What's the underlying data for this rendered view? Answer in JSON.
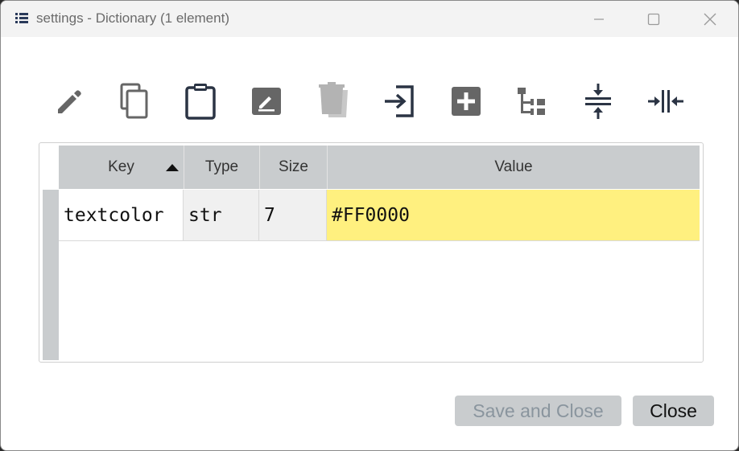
{
  "window": {
    "title": "settings - Dictionary (1 element)"
  },
  "toolbar": {
    "tools": [
      {
        "icon": "edit-pencil-icon"
      },
      {
        "icon": "copy-icon"
      },
      {
        "icon": "paste-clipboard-icon"
      },
      {
        "icon": "rename-icon"
      },
      {
        "icon": "delete-icon"
      },
      {
        "icon": "import-icon"
      },
      {
        "icon": "insert-icon"
      },
      {
        "icon": "tree-view-icon"
      },
      {
        "icon": "collapse-rows-icon"
      },
      {
        "icon": "resize-columns-icon"
      }
    ]
  },
  "table": {
    "columns": {
      "key": "Key",
      "type": "Type",
      "size": "Size",
      "value": "Value"
    },
    "sorted_column": "Key",
    "rows": [
      {
        "key": "textcolor",
        "type": "str",
        "size": "7",
        "value": "#FF0000"
      }
    ]
  },
  "buttons": {
    "save_close": "Save and Close",
    "close": "Close"
  },
  "colors": {
    "header_bg": "#c9ccce",
    "value_highlight": "#fff07f",
    "readonly_cell": "#f0f0f0"
  }
}
